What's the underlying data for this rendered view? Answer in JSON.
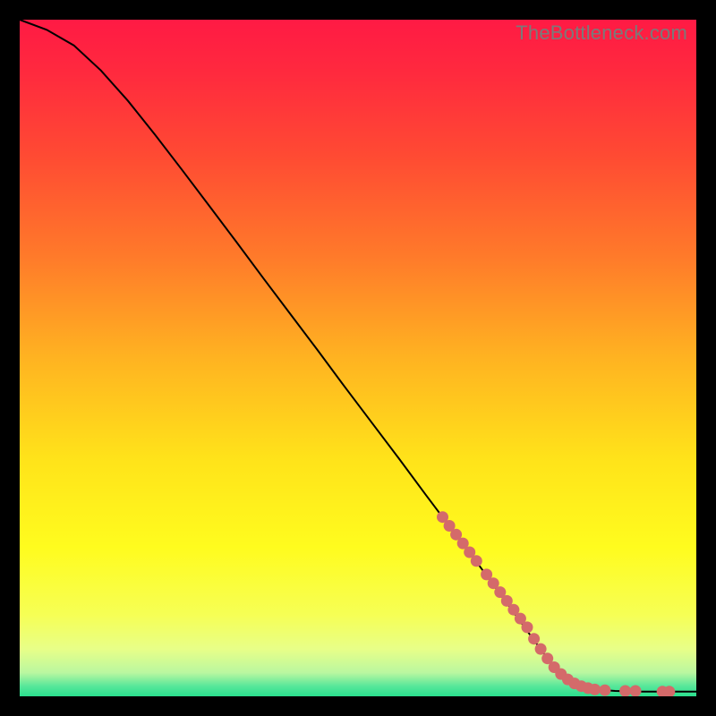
{
  "watermark": "TheBottleneck.com",
  "colors": {
    "black": "#000000",
    "curve": "#000000",
    "marker_fill": "#d46a6a",
    "marker_stroke": "#c95c5c",
    "gradient_stops": [
      {
        "offset": 0.0,
        "color": "#ff1a44"
      },
      {
        "offset": 0.08,
        "color": "#ff2a3e"
      },
      {
        "offset": 0.2,
        "color": "#ff4a33"
      },
      {
        "offset": 0.35,
        "color": "#ff7a2a"
      },
      {
        "offset": 0.5,
        "color": "#ffb321"
      },
      {
        "offset": 0.65,
        "color": "#ffe31a"
      },
      {
        "offset": 0.78,
        "color": "#fffc1e"
      },
      {
        "offset": 0.88,
        "color": "#f6ff55"
      },
      {
        "offset": 0.93,
        "color": "#e8ff88"
      },
      {
        "offset": 0.965,
        "color": "#baf7a0"
      },
      {
        "offset": 0.985,
        "color": "#57e79a"
      },
      {
        "offset": 1.0,
        "color": "#2adf8e"
      }
    ]
  },
  "chart_data": {
    "type": "line",
    "title": "",
    "xlabel": "",
    "ylabel": "",
    "xlim": [
      0,
      100
    ],
    "ylim": [
      0,
      100
    ],
    "grid": false,
    "series": [
      {
        "name": "curve",
        "x": [
          0,
          4,
          8,
          12,
          16,
          20,
          24,
          28,
          32,
          36,
          40,
          44,
          48,
          52,
          56,
          60,
          64,
          68,
          72,
          76,
          79,
          81,
          83,
          85,
          88,
          92,
          96,
          100
        ],
        "y": [
          100,
          98.5,
          96.2,
          92.5,
          88.0,
          83.0,
          77.8,
          72.5,
          67.2,
          61.8,
          56.5,
          51.2,
          45.8,
          40.5,
          35.2,
          29.8,
          24.5,
          19.2,
          13.8,
          8.3,
          4.3,
          2.5,
          1.5,
          1.0,
          0.8,
          0.7,
          0.7,
          0.7
        ]
      }
    ],
    "markers": {
      "name": "highlight-dots",
      "color": "#d46a6a",
      "points": [
        {
          "x": 62.5,
          "y": 26.5
        },
        {
          "x": 63.5,
          "y": 25.2
        },
        {
          "x": 64.5,
          "y": 23.9
        },
        {
          "x": 65.5,
          "y": 22.6
        },
        {
          "x": 66.5,
          "y": 21.3
        },
        {
          "x": 67.5,
          "y": 20.0
        },
        {
          "x": 69.0,
          "y": 18.0
        },
        {
          "x": 70.0,
          "y": 16.7
        },
        {
          "x": 71.0,
          "y": 15.4
        },
        {
          "x": 72.0,
          "y": 14.1
        },
        {
          "x": 73.0,
          "y": 12.8
        },
        {
          "x": 74.0,
          "y": 11.5
        },
        {
          "x": 75.0,
          "y": 10.2
        },
        {
          "x": 76.0,
          "y": 8.5
        },
        {
          "x": 77.0,
          "y": 7.0
        },
        {
          "x": 78.0,
          "y": 5.6
        },
        {
          "x": 79.0,
          "y": 4.3
        },
        {
          "x": 80.0,
          "y": 3.3
        },
        {
          "x": 81.0,
          "y": 2.5
        },
        {
          "x": 82.0,
          "y": 1.9
        },
        {
          "x": 83.0,
          "y": 1.5
        },
        {
          "x": 84.0,
          "y": 1.2
        },
        {
          "x": 85.0,
          "y": 1.0
        },
        {
          "x": 86.5,
          "y": 0.9
        },
        {
          "x": 89.5,
          "y": 0.8
        },
        {
          "x": 91.0,
          "y": 0.8
        },
        {
          "x": 95.0,
          "y": 0.7
        },
        {
          "x": 96.0,
          "y": 0.7
        }
      ]
    }
  }
}
